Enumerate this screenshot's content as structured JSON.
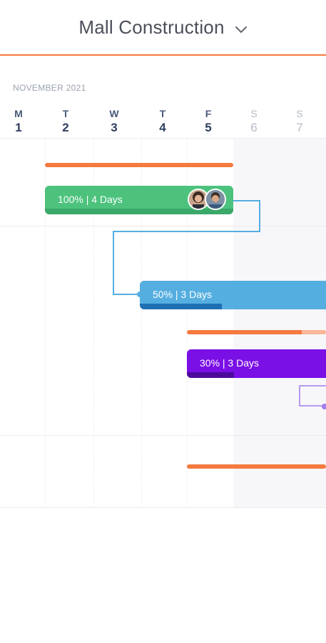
{
  "header": {
    "project_title": "Mall Construction"
  },
  "calendar": {
    "month": "NOVEMBER 2021",
    "days": [
      {
        "letter": "M",
        "number": "1",
        "weekend": false
      },
      {
        "letter": "T",
        "number": "2",
        "weekend": false
      },
      {
        "letter": "W",
        "number": "3",
        "weekend": false
      },
      {
        "letter": "T",
        "number": "4",
        "weekend": false
      },
      {
        "letter": "F",
        "number": "5",
        "weekend": false
      },
      {
        "letter": "S",
        "number": "6",
        "weekend": true
      },
      {
        "letter": "S",
        "number": "7",
        "weekend": true
      }
    ]
  },
  "tasks": [
    {
      "label": "100% | 4 Days",
      "progress": 1.0,
      "color": "#4cc27d"
    },
    {
      "label": "50% | 3 Days",
      "progress": 0.5,
      "color": "#55aee0"
    },
    {
      "label": "30% | 3 Days",
      "progress": 0.3,
      "color": "#7a0fe6"
    }
  ],
  "colors": {
    "accent": "#f47a3f",
    "text": "#4b4f59",
    "weekend_shade": "#f7f7fa"
  },
  "icons": [
    "chevron-down-icon",
    "avatar-woman",
    "avatar-man"
  ]
}
